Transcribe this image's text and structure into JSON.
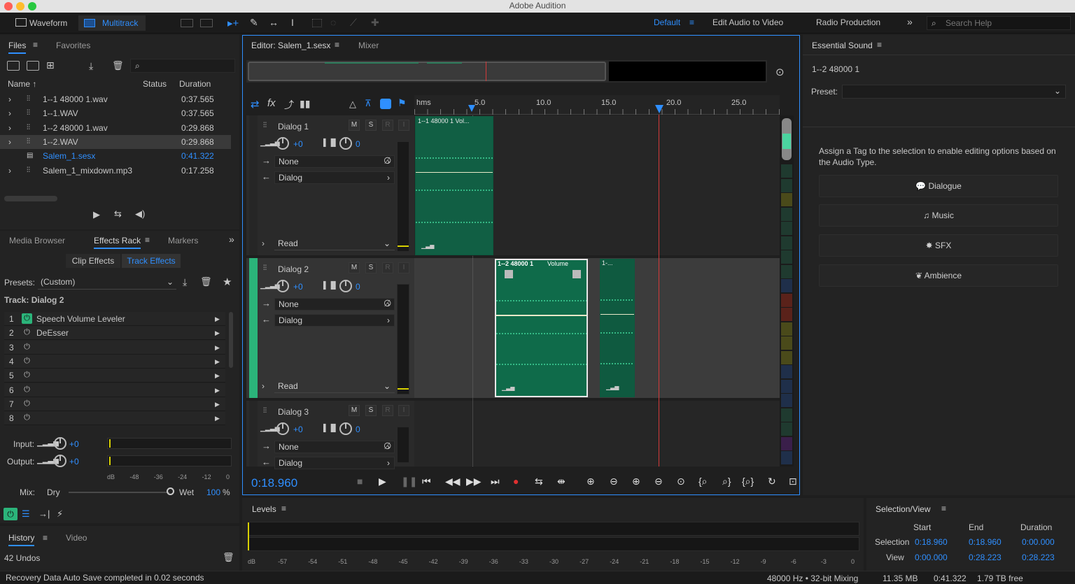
{
  "app": {
    "title": "Adobe Audition"
  },
  "toolbar": {
    "waveform": "Waveform",
    "multitrack": "Multitrack",
    "workspaces": [
      "Default",
      "Edit Audio to Video",
      "Radio Production"
    ],
    "search_placeholder": "Search Help"
  },
  "files": {
    "tab_files": "Files",
    "tab_favorites": "Favorites",
    "col_name": "Name",
    "col_status": "Status",
    "col_duration": "Duration",
    "items": [
      {
        "name": "1--1 48000 1.wav",
        "duration": "0:37.565"
      },
      {
        "name": "1--1.WAV",
        "duration": "0:37.565"
      },
      {
        "name": "1--2 48000 1.wav",
        "duration": "0:29.868"
      },
      {
        "name": "1--2.WAV",
        "duration": "0:29.868"
      },
      {
        "name": "Salem_1.sesx",
        "duration": "0:41.322"
      },
      {
        "name": "Salem_1_mixdown.mp3",
        "duration": "0:17.258"
      }
    ]
  },
  "effects": {
    "tab_media": "Media Browser",
    "tab_rack": "Effects Rack",
    "tab_markers": "Markers",
    "sub_clip": "Clip Effects",
    "sub_track": "Track Effects",
    "presets_label": "Presets:",
    "presets_value": "(Custom)",
    "track_label": "Track: Dialog 2",
    "slots": [
      {
        "n": "1",
        "name": "Speech Volume Leveler"
      },
      {
        "n": "2",
        "name": "DeEsser"
      },
      {
        "n": "3",
        "name": ""
      },
      {
        "n": "4",
        "name": ""
      },
      {
        "n": "5",
        "name": ""
      },
      {
        "n": "6",
        "name": ""
      },
      {
        "n": "7",
        "name": ""
      },
      {
        "n": "8",
        "name": ""
      }
    ],
    "input_label": "Input:",
    "input_val": "+0",
    "output_label": "Output:",
    "output_val": "+0",
    "db_scale": [
      "dB",
      "-48",
      "-36",
      "-24",
      "-12",
      "0"
    ],
    "mix_label": "Mix:",
    "dry": "Dry",
    "wet": "Wet",
    "wet_val": "100",
    "wet_unit": "%"
  },
  "history": {
    "tab_history": "History",
    "tab_video": "Video",
    "undos": "42 Undos"
  },
  "editor": {
    "tab_editor": "Editor: Salem_1.sesx",
    "tab_mixer": "Mixer",
    "ruler_unit": "hms",
    "ruler_ticks": [
      "5.0",
      "10.0",
      "15.0",
      "20.0",
      "25.0"
    ],
    "time": "0:18.960",
    "tracks": [
      {
        "name": "Dialog 1",
        "vol": "+0",
        "pan": "0",
        "input": "None",
        "output": "Dialog",
        "mode": "Read"
      },
      {
        "name": "Dialog 2",
        "vol": "+0",
        "pan": "0",
        "input": "None",
        "output": "Dialog",
        "mode": "Read"
      },
      {
        "name": "Dialog 3",
        "vol": "+0",
        "pan": "0",
        "input": "None",
        "output": "Dialog",
        "mode": ""
      }
    ],
    "clips": {
      "c1": "1--1 48000 1 Vol...",
      "c2": "1--2 48000 1",
      "c2_vol": "Volume",
      "c3": "1-..."
    },
    "msr": {
      "m": "M",
      "s": "S",
      "r": "R",
      "i": "I"
    }
  },
  "essential": {
    "title": "Essential Sound",
    "clip": "1--2 48000 1",
    "preset_label": "Preset:",
    "hint": "Assign a Tag to the selection to enable editing options based on the Audio Type.",
    "buttons": [
      "Dialogue",
      "Music",
      "SFX",
      "Ambience"
    ]
  },
  "levels": {
    "title": "Levels",
    "scale": [
      "dB",
      "-57",
      "-54",
      "-51",
      "-48",
      "-45",
      "-42",
      "-39",
      "-36",
      "-33",
      "-30",
      "-27",
      "-24",
      "-21",
      "-18",
      "-15",
      "-12",
      "-9",
      "-6",
      "-3",
      "0"
    ]
  },
  "selection": {
    "title": "Selection/View",
    "col_start": "Start",
    "col_end": "End",
    "col_duration": "Duration",
    "sel_label": "Selection",
    "sel_start": "0:18.960",
    "sel_end": "0:18.960",
    "sel_dur": "0:00.000",
    "view_label": "View",
    "view_start": "0:00.000",
    "view_end": "0:28.223",
    "view_dur": "0:28.223"
  },
  "status": {
    "left": "Recovery Data Auto Save completed in 0.02 seconds",
    "rate": "48000 Hz • 32-bit Mixing",
    "mem": "11.35 MB",
    "dur": "0:41.322",
    "free": "1.79 TB free"
  }
}
